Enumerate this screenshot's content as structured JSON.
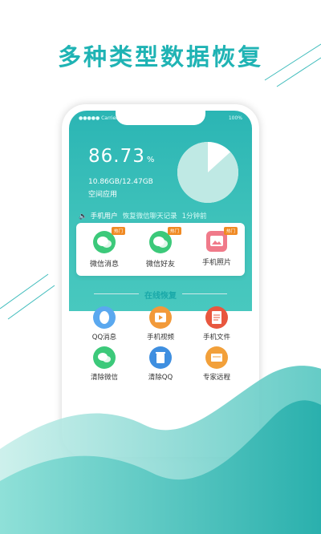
{
  "headline": "多种类型数据恢复",
  "status": {
    "carrier": "●●●●● Carrier",
    "battery": "100%"
  },
  "storage": {
    "percent": "86.73",
    "percent_unit": "%",
    "used_total": "10.86GB/12.47GB",
    "label": "空间应用",
    "used_fraction": 0.8673
  },
  "notice": {
    "user": "手机用户",
    "message": "恢复微信聊天记录",
    "time": "1分钟前"
  },
  "tools": [
    {
      "label": "微信消息",
      "badge": "热门",
      "icon": "wechat-message-icon",
      "color": "#3cc97a"
    },
    {
      "label": "微信好友",
      "badge": "热门",
      "icon": "wechat-friends-icon",
      "color": "#3cc97a"
    },
    {
      "label": "手机照片",
      "badge": "热门",
      "icon": "photo-icon",
      "color": "#f07a8a"
    }
  ],
  "section_title": "在线恢复",
  "grid": [
    {
      "label": "QQ消息",
      "icon": "qq-icon",
      "color": "#5aa8ef"
    },
    {
      "label": "手机视频",
      "icon": "video-icon",
      "color": "#f29a3a"
    },
    {
      "label": "手机文件",
      "icon": "file-icon",
      "color": "#e8573f"
    },
    {
      "label": "清除微信",
      "icon": "wechat-clean-icon",
      "color": "#3cc97a"
    },
    {
      "label": "清除QQ",
      "icon": "qq-clean-icon",
      "color": "#3f8fe0"
    },
    {
      "label": "专家远程",
      "icon": "remote-expert-icon",
      "color": "#f2a03a"
    }
  ],
  "colors": {
    "teal": "#1fb3b4",
    "teal_light": "#48c8bf",
    "badge": "#f08a24"
  }
}
